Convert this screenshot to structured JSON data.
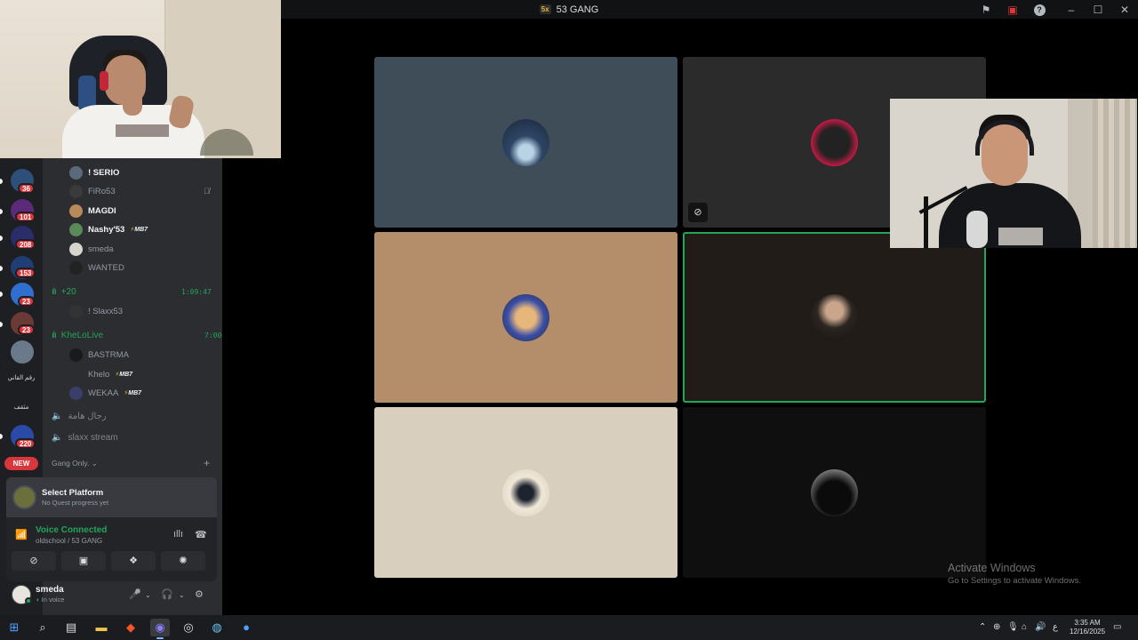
{
  "window": {
    "server_badge": "5x",
    "title": "53 GANG"
  },
  "rail": {
    "badges": [
      "36",
      "101",
      "208",
      "153",
      "23",
      "23",
      "220"
    ],
    "server_labels": [
      "رقم القاني",
      "مثقف"
    ],
    "new_label": "NEW"
  },
  "voice_members_top": [
    {
      "name": "! SERIO",
      "active": true
    },
    {
      "name": "FiRo53",
      "active": false
    },
    {
      "name": "MAGDI",
      "active": true
    },
    {
      "name": "Nashy'53",
      "active": true,
      "tag": "MB7"
    },
    {
      "name": "smeda",
      "active": false
    },
    {
      "name": "WANTED",
      "active": false
    }
  ],
  "channel_1": {
    "name": "+20",
    "time": "1:09:47",
    "members": [
      {
        "name": "! Slaxx53"
      }
    ]
  },
  "channel_2": {
    "name": "KheLoLive",
    "time": "7:00",
    "members": [
      {
        "name": "BASTRMA"
      },
      {
        "name": "Khelo",
        "tag": "MB7"
      },
      {
        "name": "WEKAA",
        "tag": "MB7"
      }
    ]
  },
  "channel_3": {
    "name": "رجال هامة"
  },
  "channel_4": {
    "name": "slaxx stream"
  },
  "category": {
    "name": "Gang Only."
  },
  "quest": {
    "title": "Select Platform",
    "subtitle": "No Quest progress yet"
  },
  "voice_panel": {
    "status": "Voice Connected",
    "location": "oldschool / 53 GANG"
  },
  "user_panel": {
    "name": "smeda",
    "status": "In voice"
  },
  "watermark": {
    "line1": "Activate Windows",
    "line2": "Go to Settings to activate Windows."
  },
  "clock": {
    "time": "3:35 AM",
    "date": "12/16/2025"
  },
  "tray": {
    "lang": "ع"
  },
  "colors": {
    "accent_green": "#23a55a",
    "badge_red": "#da373c",
    "bg_dark": "#2b2d31"
  }
}
